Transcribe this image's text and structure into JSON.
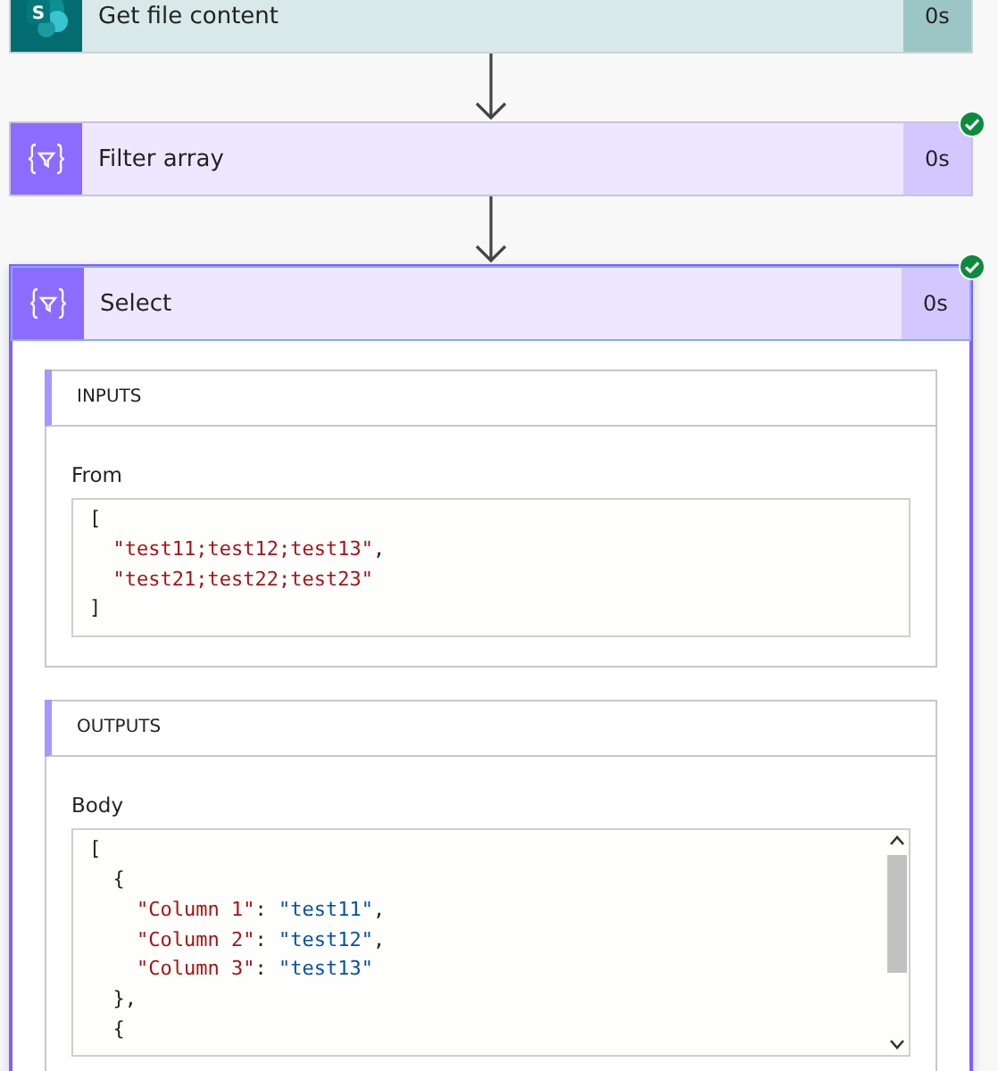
{
  "steps": [
    {
      "kind": "sharepoint",
      "logo_text": "S",
      "title": "Get file content",
      "duration": "0s",
      "expanded": false
    },
    {
      "kind": "data",
      "title": "Filter array",
      "duration": "0s",
      "succeeded": true,
      "expanded": false
    },
    {
      "kind": "data",
      "title": "Select",
      "duration": "0s",
      "succeeded": true,
      "expanded": true,
      "sections": [
        {
          "heading": "INPUTS",
          "field_label": "From",
          "scrollable": false,
          "lines": [
            [
              {
                "kind": "punct",
                "text": "["
              }
            ],
            [
              {
                "kind": "key",
                "text": "  \"test11;test12;test13\""
              },
              {
                "kind": "punct",
                "text": ","
              }
            ],
            [
              {
                "kind": "key",
                "text": "  \"test21;test22;test23\""
              }
            ],
            [
              {
                "kind": "punct",
                "text": "]"
              }
            ]
          ]
        },
        {
          "heading": "OUTPUTS",
          "field_label": "Body",
          "scrollable": true,
          "lines": [
            [
              {
                "kind": "punct",
                "text": "["
              }
            ],
            [
              {
                "kind": "punct",
                "text": "  {"
              }
            ],
            [
              {
                "kind": "key",
                "text": "    \"Column 1\""
              },
              {
                "kind": "punct",
                "text": ": "
              },
              {
                "kind": "value",
                "text": "\"test11\""
              },
              {
                "kind": "punct",
                "text": ","
              }
            ],
            [
              {
                "kind": "key",
                "text": "    \"Column 2\""
              },
              {
                "kind": "punct",
                "text": ": "
              },
              {
                "kind": "value",
                "text": "\"test12\""
              },
              {
                "kind": "punct",
                "text": ","
              }
            ],
            [
              {
                "kind": "key",
                "text": "    \"Column 3\""
              },
              {
                "kind": "punct",
                "text": ": "
              },
              {
                "kind": "value",
                "text": "\"test13\""
              }
            ],
            [
              {
                "kind": "punct",
                "text": "  },"
              }
            ],
            [
              {
                "kind": "punct",
                "text": "  {"
              }
            ]
          ]
        }
      ]
    }
  ]
}
